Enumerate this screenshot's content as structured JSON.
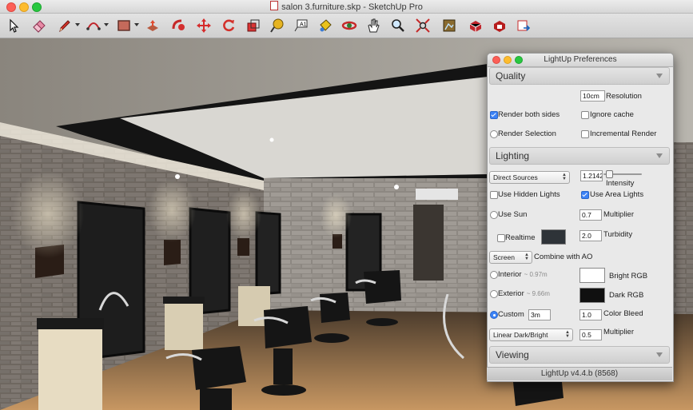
{
  "window": {
    "title": "salon 3.furniture.skp - SketchUp Pro"
  },
  "toolbar": {
    "tools": [
      {
        "name": "select-tool",
        "icon": "arrow-cursor-icon"
      },
      {
        "name": "eraser-tool",
        "icon": "eraser-icon"
      },
      {
        "name": "line-tool",
        "icon": "pencil-icon"
      },
      {
        "name": "arc-tool",
        "icon": "arc-icon"
      },
      {
        "name": "rectangle-tool",
        "icon": "rectangle-icon"
      },
      {
        "name": "push-pull-tool",
        "icon": "push-pull-icon"
      },
      {
        "name": "follow-me-tool",
        "icon": "follow-me-icon"
      },
      {
        "name": "move-tool",
        "icon": "move-icon"
      },
      {
        "name": "rotate-tool",
        "icon": "rotate-icon"
      },
      {
        "name": "scale-tool",
        "icon": "scale-icon"
      },
      {
        "name": "tape-measure-tool",
        "icon": "tape-measure-icon"
      },
      {
        "name": "text-tool",
        "icon": "text-icon"
      },
      {
        "name": "paint-bucket-tool",
        "icon": "paint-bucket-icon"
      },
      {
        "name": "orbit-tool",
        "icon": "orbit-icon"
      },
      {
        "name": "pan-tool",
        "icon": "hand-icon"
      },
      {
        "name": "zoom-tool",
        "icon": "magnifier-icon"
      },
      {
        "name": "zoom-extents-tool",
        "icon": "zoom-extents-icon"
      },
      {
        "name": "warehouse-tool",
        "icon": "warehouse-icon"
      },
      {
        "name": "extension-warehouse-tool",
        "icon": "extension-icon"
      },
      {
        "name": "sketchup-store-tool",
        "icon": "store-icon"
      },
      {
        "name": "share-model-tool",
        "icon": "share-icon"
      }
    ]
  },
  "panel": {
    "title": "LightUp Preferences",
    "footer": "LightUp v4.4.b (8568)",
    "quality": {
      "header": "Quality",
      "resolution_value": "10cm",
      "resolution_label": "Resolution",
      "render_both_sides": "Render both sides",
      "ignore_cache": "Ignore cache",
      "render_selection": "Render Selection",
      "incremental_render": "Incremental Render"
    },
    "lighting": {
      "header": "Lighting",
      "source_select": "Direct Sources",
      "intensity_value": "1.2142",
      "intensity_label": "Intensity",
      "intensity_fraction": 0.08,
      "use_hidden_lights": "Use Hidden Lights",
      "use_area_lights": "Use Area Lights",
      "use_sun": "Use Sun",
      "multiplier_value": "0.7",
      "multiplier_label": "Multiplier",
      "realtime": "Realtime",
      "turbidity_value": "2.0",
      "turbidity_label": "Turbidity",
      "ao_select": "Screen",
      "combine_ao": "Combine with AO",
      "interior": "Interior",
      "interior_hint": "~ 0.97m",
      "bright_rgb": "Bright RGB",
      "exterior": "Exterior",
      "exterior_hint": "~ 9.66m",
      "dark_rgb": "Dark RGB",
      "custom": "Custom",
      "custom_value": "3m",
      "color_bleed_value": "1.0",
      "color_bleed_label": "Color Bleed",
      "ramp_select": "Linear Dark/Bright",
      "multiplier2_value": "0.5",
      "multiplier2_label": "Multiplier"
    },
    "viewing": {
      "header": "Viewing"
    },
    "colors": {
      "bright": "#ffffff",
      "dark": "#101010",
      "realtime_swatch": "#2e3338"
    }
  }
}
